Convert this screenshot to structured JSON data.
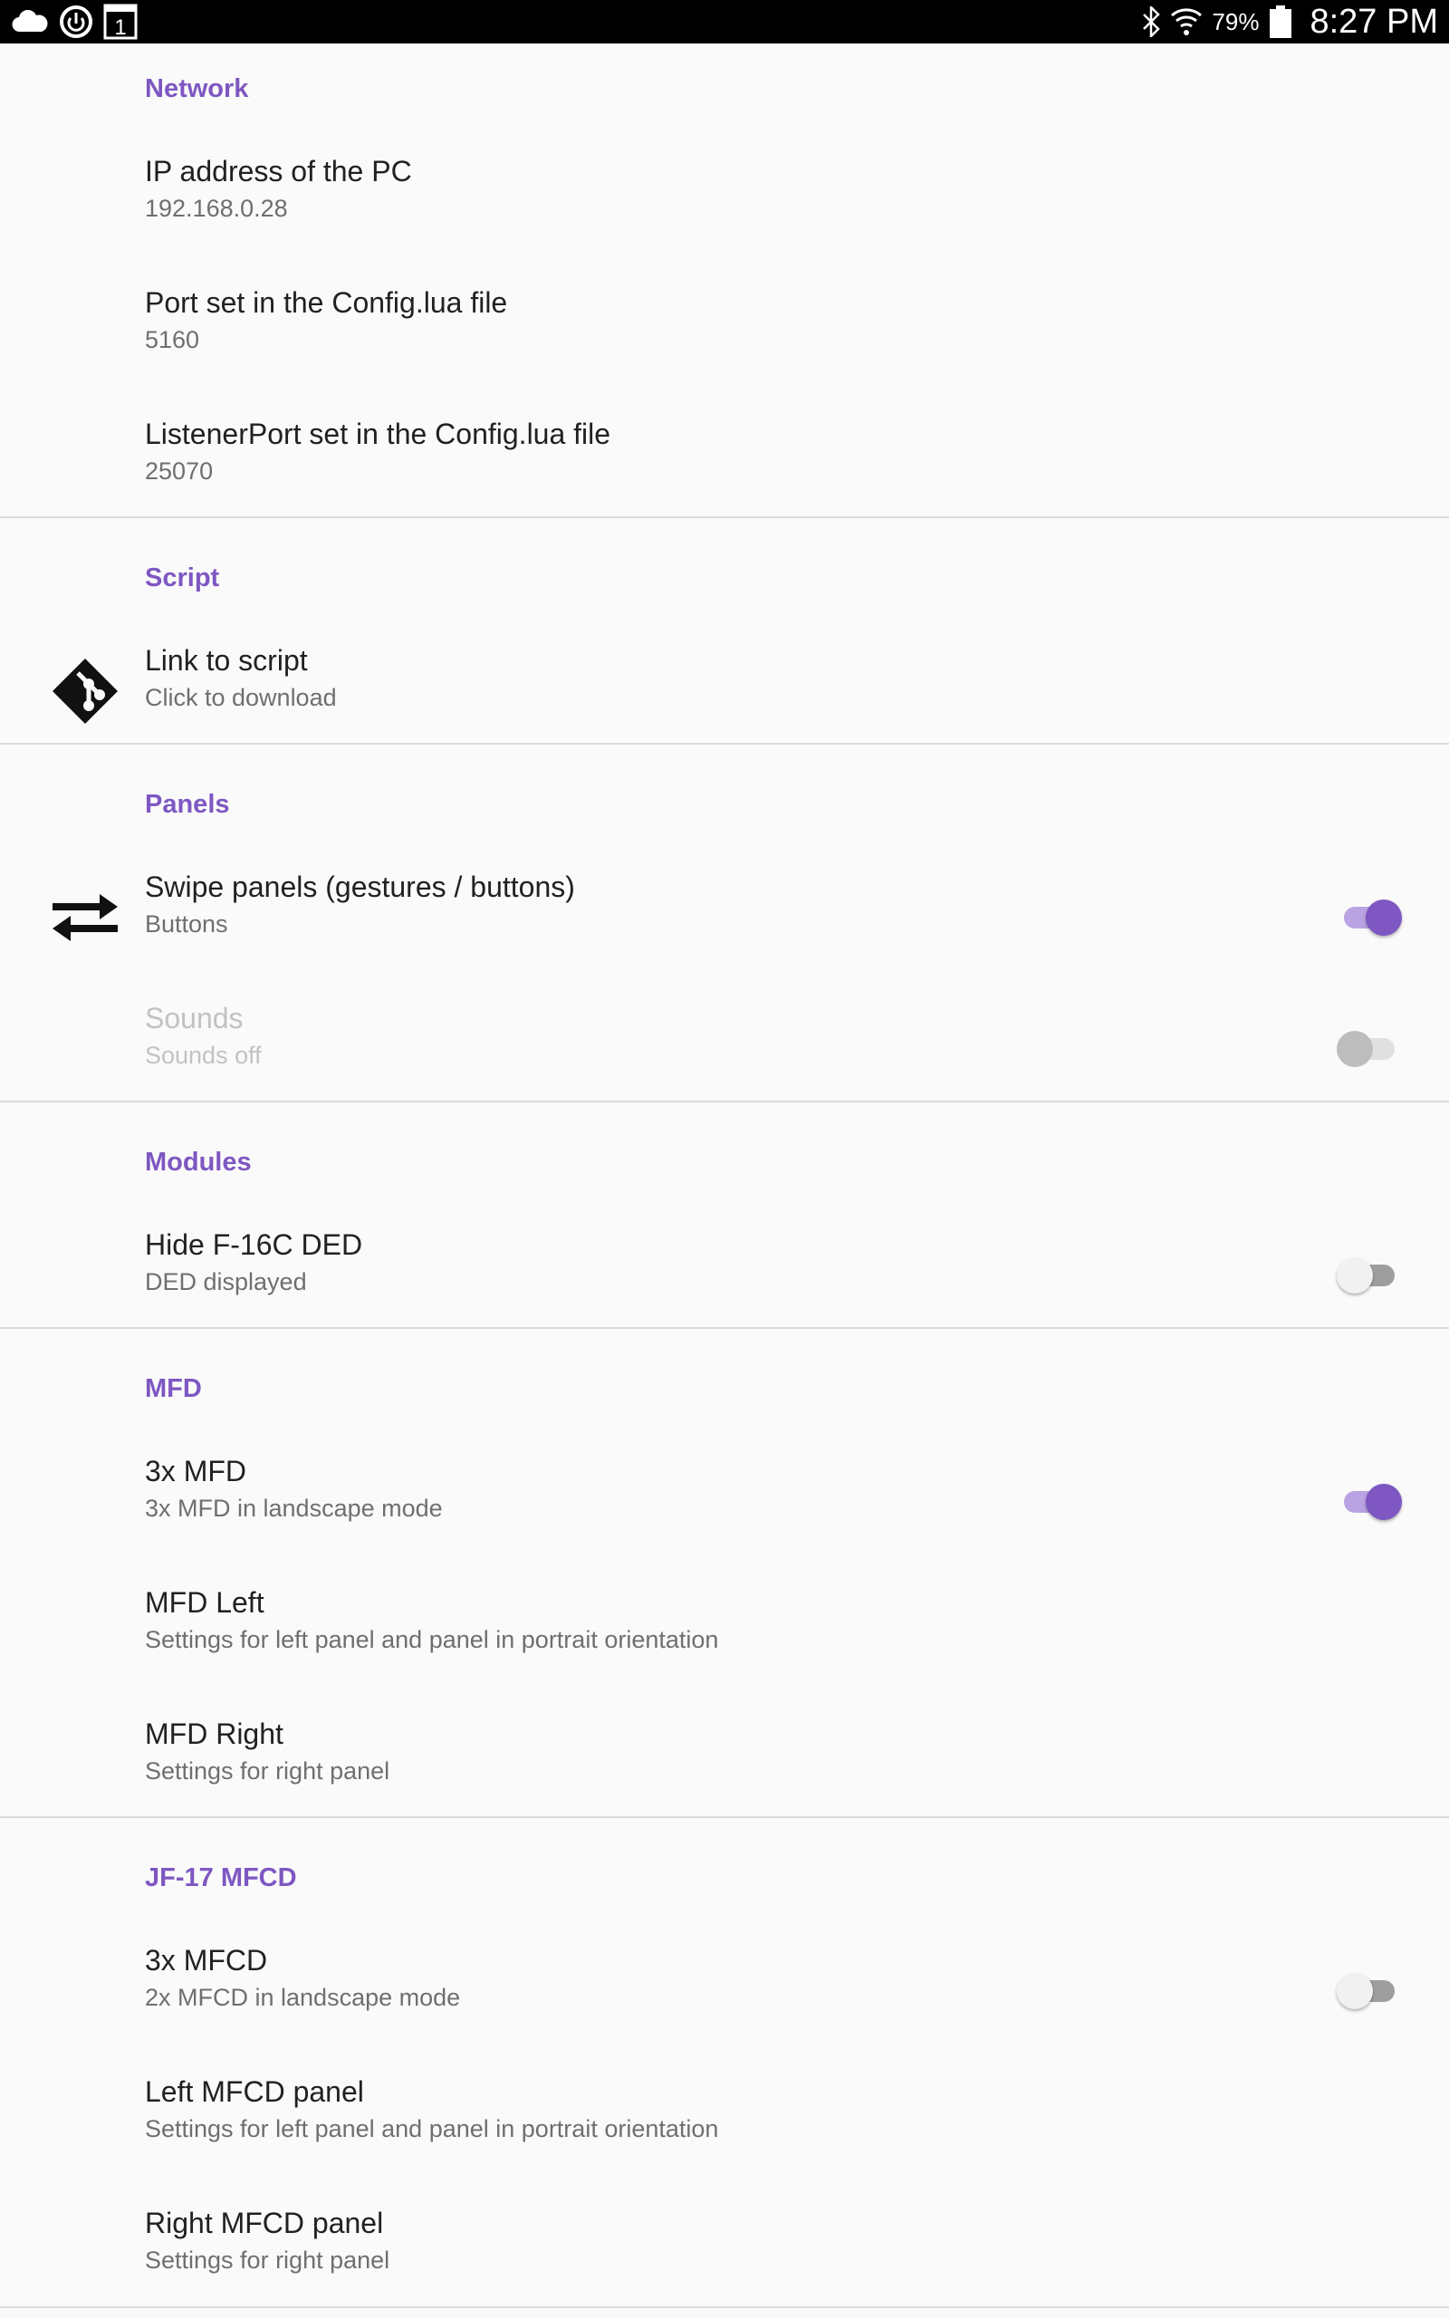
{
  "status_bar": {
    "battery": "79%",
    "time": "8:27 PM",
    "notification_badge": "1",
    "icons": [
      "cloud-icon",
      "sync-icon",
      "calendar-icon",
      "bluetooth-icon",
      "wifi-icon",
      "battery-icon"
    ]
  },
  "colors": {
    "accent": "#7e57c2",
    "accent_light": "#b9a3e3",
    "background": "#fafafa",
    "divider": "#dcdcdc"
  },
  "network": {
    "header": "Network",
    "ip": {
      "title": "IP address of the PC",
      "summary": "192.168.0.28"
    },
    "port": {
      "title": "Port set in the Config.lua file",
      "summary": "5160"
    },
    "listener": {
      "title": "ListenerPort set in the Config.lua file",
      "summary": "25070"
    }
  },
  "script": {
    "header": "Script",
    "link": {
      "title": "Link to script",
      "summary": "Click to download",
      "icon": "git-icon"
    }
  },
  "panels": {
    "header": "Panels",
    "swipe": {
      "title": "Swipe panels (gestures / buttons)",
      "summary": "Buttons",
      "icon": "swap-arrows-icon",
      "enabled": true
    },
    "sounds": {
      "title": "Sounds",
      "summary": "Sounds off",
      "enabled": false,
      "disabled": true
    }
  },
  "modules": {
    "header": "Modules",
    "hide_ded": {
      "title": "Hide F-16C DED",
      "summary": "DED displayed",
      "enabled": false
    }
  },
  "mfd": {
    "header": "MFD",
    "three": {
      "title": "3x MFD",
      "summary": "3x MFD in landscape mode",
      "enabled": true
    },
    "left": {
      "title": "MFD Left",
      "summary": "Settings for left panel and panel in portrait orientation"
    },
    "right": {
      "title": "MFD Right",
      "summary": "Settings for right panel"
    }
  },
  "jf17": {
    "header": "JF-17 MFCD",
    "three": {
      "title": "3x MFCD",
      "summary": "2x MFCD in landscape mode",
      "enabled": false
    },
    "left": {
      "title": "Left MFCD panel",
      "summary": "Settings for left panel and panel in portrait orientation"
    },
    "right": {
      "title": "Right MFCD panel",
      "summary": "Settings for right panel"
    }
  }
}
